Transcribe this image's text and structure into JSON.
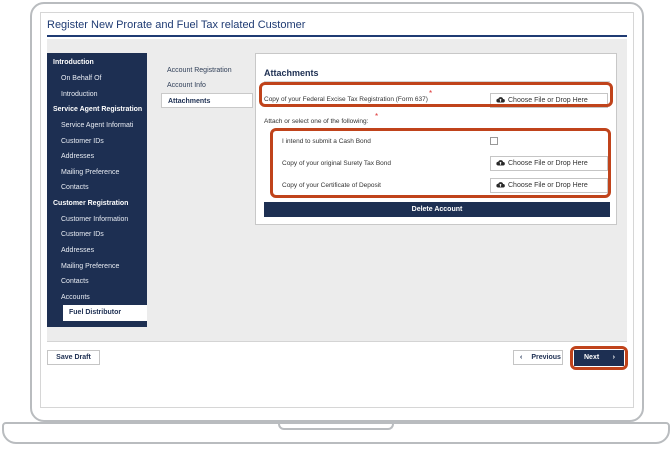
{
  "window": {
    "title": "Register New Prorate and Fuel Tax related Customer"
  },
  "sidebar": {
    "items": [
      {
        "label": "Introduction",
        "kind": "head"
      },
      {
        "label": "On Behalf Of",
        "kind": "sub"
      },
      {
        "label": "Introduction",
        "kind": "sub"
      },
      {
        "label": "Service Agent Registration",
        "kind": "head"
      },
      {
        "label": "Service Agent Informati",
        "kind": "sub"
      },
      {
        "label": "Customer IDs",
        "kind": "sub"
      },
      {
        "label": "Addresses",
        "kind": "sub"
      },
      {
        "label": "Mailing Preference",
        "kind": "sub"
      },
      {
        "label": "Contacts",
        "kind": "sub"
      },
      {
        "label": "Customer Registration",
        "kind": "head"
      },
      {
        "label": "Customer Information",
        "kind": "sub"
      },
      {
        "label": "Customer IDs",
        "kind": "sub"
      },
      {
        "label": "Addresses",
        "kind": "sub"
      },
      {
        "label": "Mailing Preference",
        "kind": "sub"
      },
      {
        "label": "Contacts",
        "kind": "sub"
      },
      {
        "label": "Accounts",
        "kind": "sub"
      },
      {
        "label": "Fuel Distributor",
        "kind": "active"
      }
    ]
  },
  "subnav": {
    "items": [
      {
        "label": "Account Registration"
      },
      {
        "label": "Account Info"
      },
      {
        "label": "Attachments",
        "active": true
      }
    ]
  },
  "attachments": {
    "title": "Attachments",
    "federal_label": "Copy of your Federal Excise Tax Registration (Form 637)",
    "required_mark": "*",
    "choose_label": "Choose File or Drop Here",
    "attach_one_label": "Attach or select one of the following:",
    "cash_bond_label": "I intend to submit a Cash Bond",
    "surety_label": "Copy of your original Surety Tax Bond",
    "cd_label": "Copy of your Certificate of Deposit",
    "delete_label": "Delete Account"
  },
  "footer": {
    "save_draft_label": "Save Draft",
    "previous_label": "Previous",
    "next_label": "Next"
  },
  "colors": {
    "navy": "#1d2f52",
    "highlight": "#c0431b",
    "required": "#dd3333"
  }
}
